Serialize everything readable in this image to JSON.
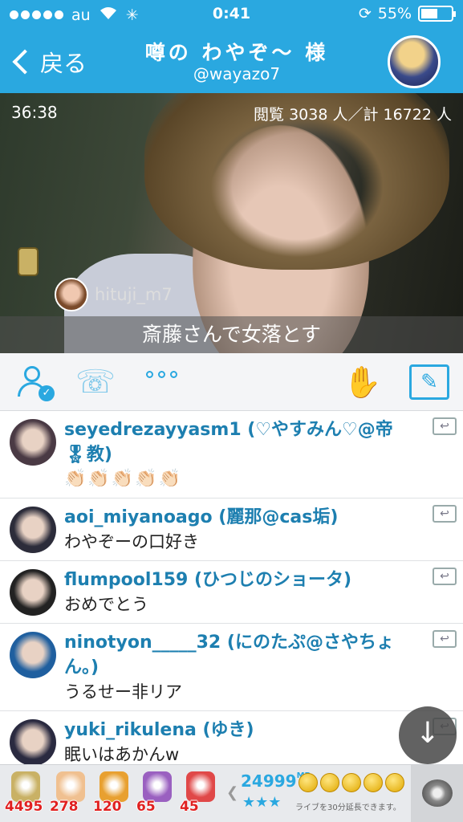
{
  "status_bar": {
    "carrier": "au",
    "time": "0:41",
    "battery": "55%",
    "battery_level": 0.55
  },
  "nav": {
    "back_label": "戻る",
    "title": "噂の わやぞ〜 様",
    "handle": "@wayazo7"
  },
  "video": {
    "elapsed": "36:38",
    "views": "閲覧 3038 人／計 16722 人",
    "overlay_user": "hituji_m7",
    "overlay_comment": "斎藤さんで女落とす"
  },
  "actions": {
    "more_label": "•••"
  },
  "comments": [
    {
      "name": "seyedrezayyasm1 (♡やすみん♡@帝🎖教)",
      "text": "👏🏻👏🏻👏🏻👏🏻👏🏻",
      "avatar_color": "#4a3a44"
    },
    {
      "name": "aoi_miyanoago (麗那@cas垢)",
      "text": "わやぞーの口好き",
      "avatar_color": "#2c2c3a"
    },
    {
      "name": "flumpool159 (ひつじのショータ)",
      "text": "おめでとう",
      "avatar_color": "#222222"
    },
    {
      "name": "ninotyon_____32 (にのたぷ@さやちょん。)",
      "text": "うるせー非リア",
      "avatar_color": "#1f5f9f"
    },
    {
      "name": "yuki_rikulena (ゆき)",
      "text": "眠いはあかんw",
      "avatar_color": "#2a2a40"
    }
  ],
  "gifts": [
    {
      "count": "4495",
      "icon": "tea-icon",
      "color": "#c9b165"
    },
    {
      "count": "278",
      "icon": "clap-icon",
      "color": "#f0c090"
    },
    {
      "count": "120",
      "icon": "cracker-icon",
      "color": "#e8a030"
    },
    {
      "count": "65",
      "icon": "fireworks-icon",
      "color": "#9a60c0"
    },
    {
      "count": "45",
      "icon": "cake-icon",
      "color": "#e04848"
    }
  ],
  "points": {
    "value": "24999",
    "unit": "MP",
    "stars": "★★★",
    "extend_text": "ライブを30分延長できます。"
  }
}
